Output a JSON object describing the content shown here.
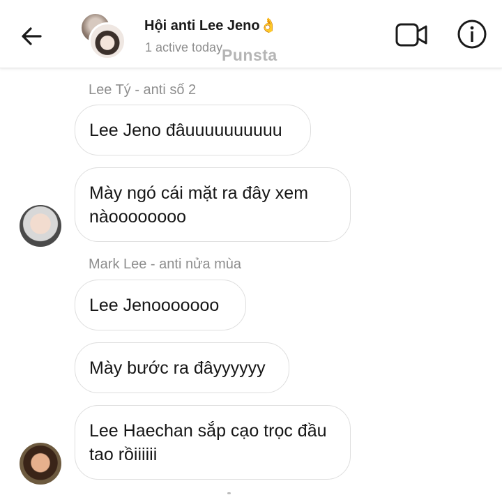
{
  "header": {
    "title": "Hội anti Lee Jeno",
    "title_emoji": "👌",
    "status": "1 active today",
    "watermark": "Punsta"
  },
  "messages": [
    {
      "sender": "Lee Tý - anti số 2",
      "bubbles": [
        "Lee Jeno đâuuuuuuuuuu",
        "Mày ngó cái mặt ra đây xem nàoooooooo"
      ]
    },
    {
      "sender": "Mark Lee - anti nửa mùa",
      "bubbles": [
        "Lee Jenooooooo",
        "Mày bước ra đâyyyyyy",
        "Lee Haechan sắp cạo trọc đầu tao rồiiiiii"
      ]
    }
  ],
  "icons": [
    "back-arrow-icon",
    "video-call-icon",
    "info-icon"
  ]
}
